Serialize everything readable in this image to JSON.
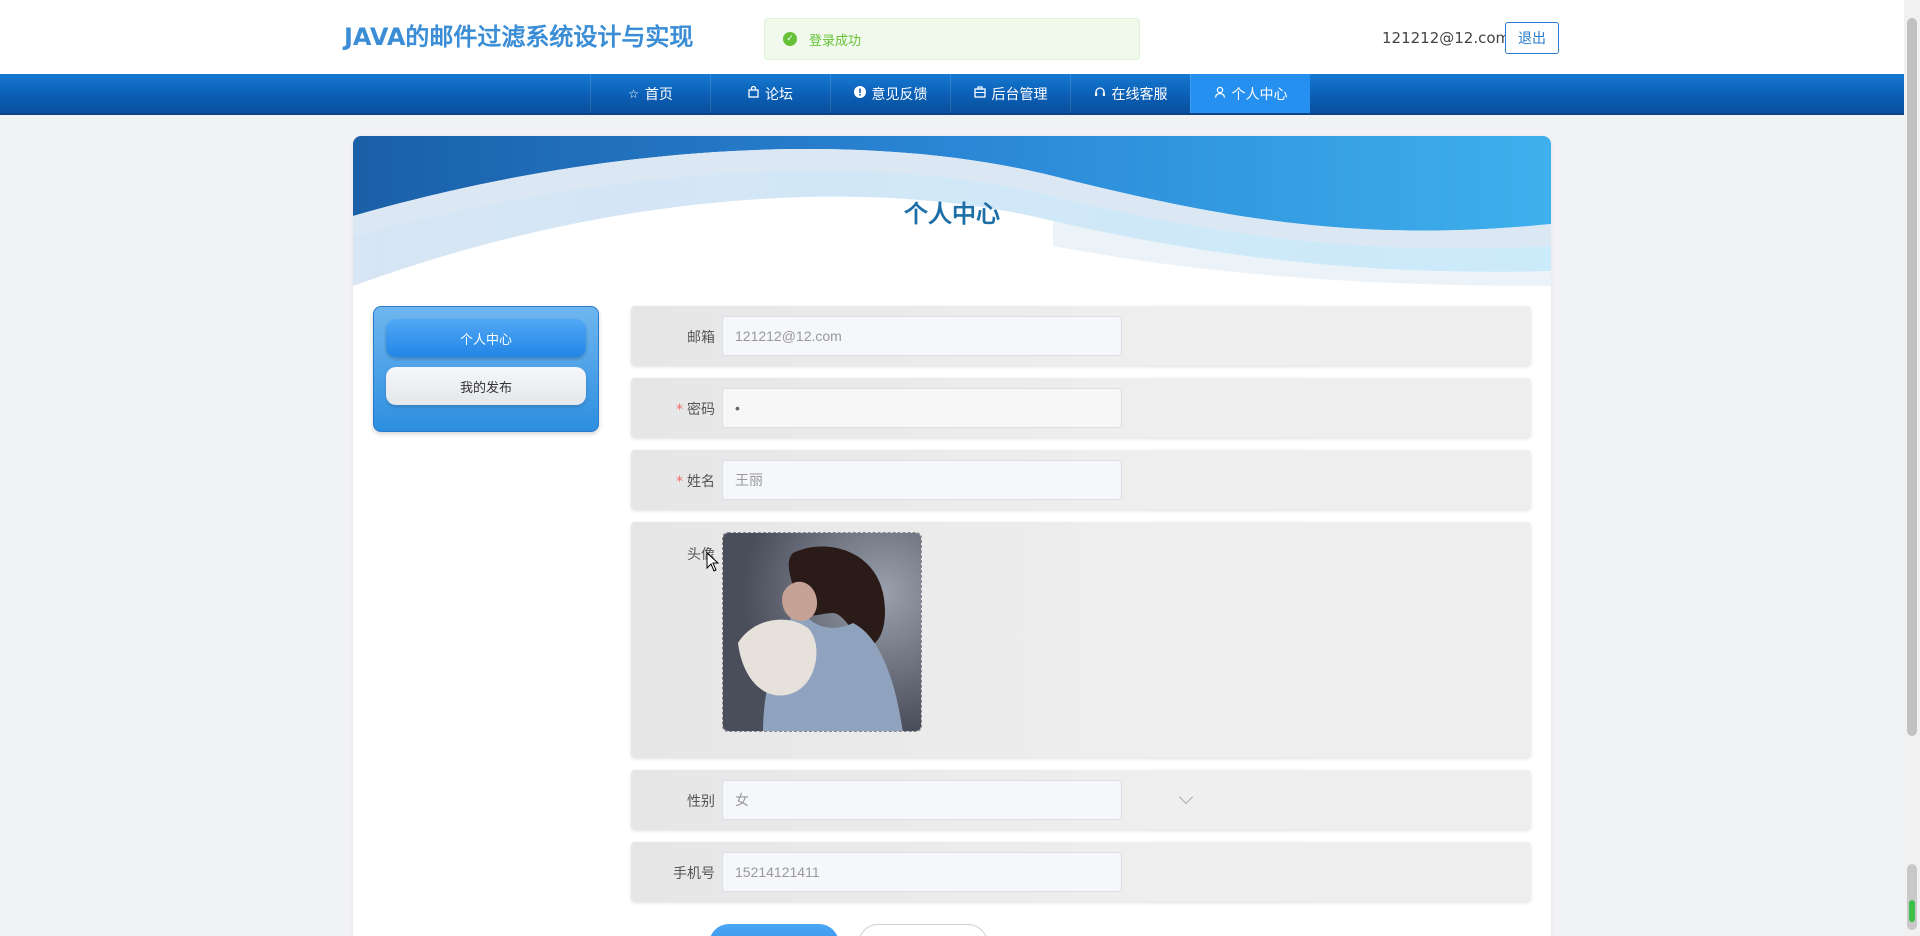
{
  "header": {
    "site_title": "JAVA的邮件过滤系统设计与实现",
    "user_email": "121212@12.com",
    "logout_label": "退出"
  },
  "toast": {
    "message": "登录成功",
    "type": "success"
  },
  "nav": {
    "items": [
      {
        "label": "首页",
        "icon": "star-icon"
      },
      {
        "label": "论坛",
        "icon": "shopping-bag-icon"
      },
      {
        "label": "意见反馈",
        "icon": "info-circle-icon"
      },
      {
        "label": "后台管理",
        "icon": "briefcase-icon"
      },
      {
        "label": "在线客服",
        "icon": "headset-icon"
      },
      {
        "label": "个人中心",
        "icon": "user-icon",
        "active": true
      }
    ]
  },
  "page": {
    "title": "个人中心"
  },
  "sidebar": {
    "items": [
      {
        "label": "个人中心",
        "active": true
      },
      {
        "label": "我的发布",
        "active": false
      }
    ]
  },
  "form": {
    "email": {
      "label": "邮箱",
      "value": "121212@12.com"
    },
    "password": {
      "label": "密码",
      "value": "•",
      "required": true
    },
    "name": {
      "label": "姓名",
      "value": "王丽",
      "required": true
    },
    "avatar": {
      "label": "头像"
    },
    "gender": {
      "label": "性别",
      "value": "女"
    },
    "phone": {
      "label": "手机号",
      "value": "15214121411"
    }
  },
  "colors": {
    "brand": "#3b8ed6",
    "nav": "#0b5fb5",
    "active": "#2590f0",
    "success": "#67c23a",
    "required": "#f56c6c"
  }
}
